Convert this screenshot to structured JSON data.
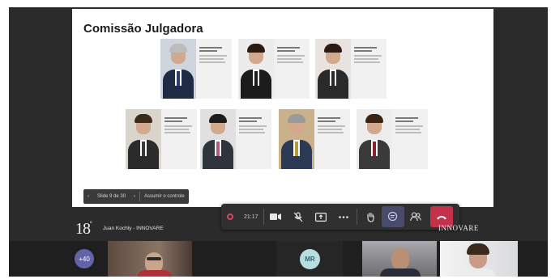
{
  "slide": {
    "title": "Comissão Julgadora",
    "navigation": {
      "prev_icon": "‹",
      "slide_counter": "Slide 9 de 30",
      "next_icon": "›",
      "take_control": "Assumir o controle"
    },
    "members_row1": [
      {
        "suit": "#1f2a44",
        "tie": "#2c3c7a",
        "hair": "#bcbcbc",
        "bg": "#cfd5dc"
      },
      {
        "suit": "#1c1c1c",
        "tie": "#1c1c1c",
        "hair": "#2a1a12",
        "bg": "#ececec"
      },
      {
        "suit": "#2a2a2a",
        "tie": "#2a2a2a",
        "hair": "#2a1a12",
        "bg": "#e8e3df"
      }
    ],
    "members_row2": [
      {
        "suit": "#2b2b2b",
        "tie": "#3a3a3a",
        "hair": "#3a2a1a",
        "bg": "#d9d4cc"
      },
      {
        "suit": "#30343d",
        "tie": "#b45a7a",
        "hair": "#1c1c1c",
        "bg": "#e0e0e0"
      },
      {
        "suit": "#2d3a55",
        "tie": "#b89a3c",
        "hair": "#9a9a9a",
        "bg": "#c9b28b"
      },
      {
        "suit": "#3a3a3a",
        "tie": "#8b2230",
        "hair": "#3a2414",
        "bg": "#ededed"
      }
    ]
  },
  "toolbar": {
    "timer": "21:17",
    "icons": [
      "camera-icon",
      "mic-off-icon",
      "share-screen-icon",
      "more-icon",
      "raise-hand-icon",
      "chat-icon",
      "participants-icon",
      "hang-up-icon"
    ]
  },
  "stream_banner": {
    "logo_number": "18",
    "logo_suffix": "º",
    "speaker": "Juan Kochly - INNOVARE",
    "brand": "INNOVARE"
  },
  "gallery": {
    "overflow_count": "+40",
    "avatar_initials": "MR"
  },
  "colors": {
    "accent": "#6264a7",
    "hangup": "#c4314b",
    "toolbar_bg": "#303030"
  }
}
